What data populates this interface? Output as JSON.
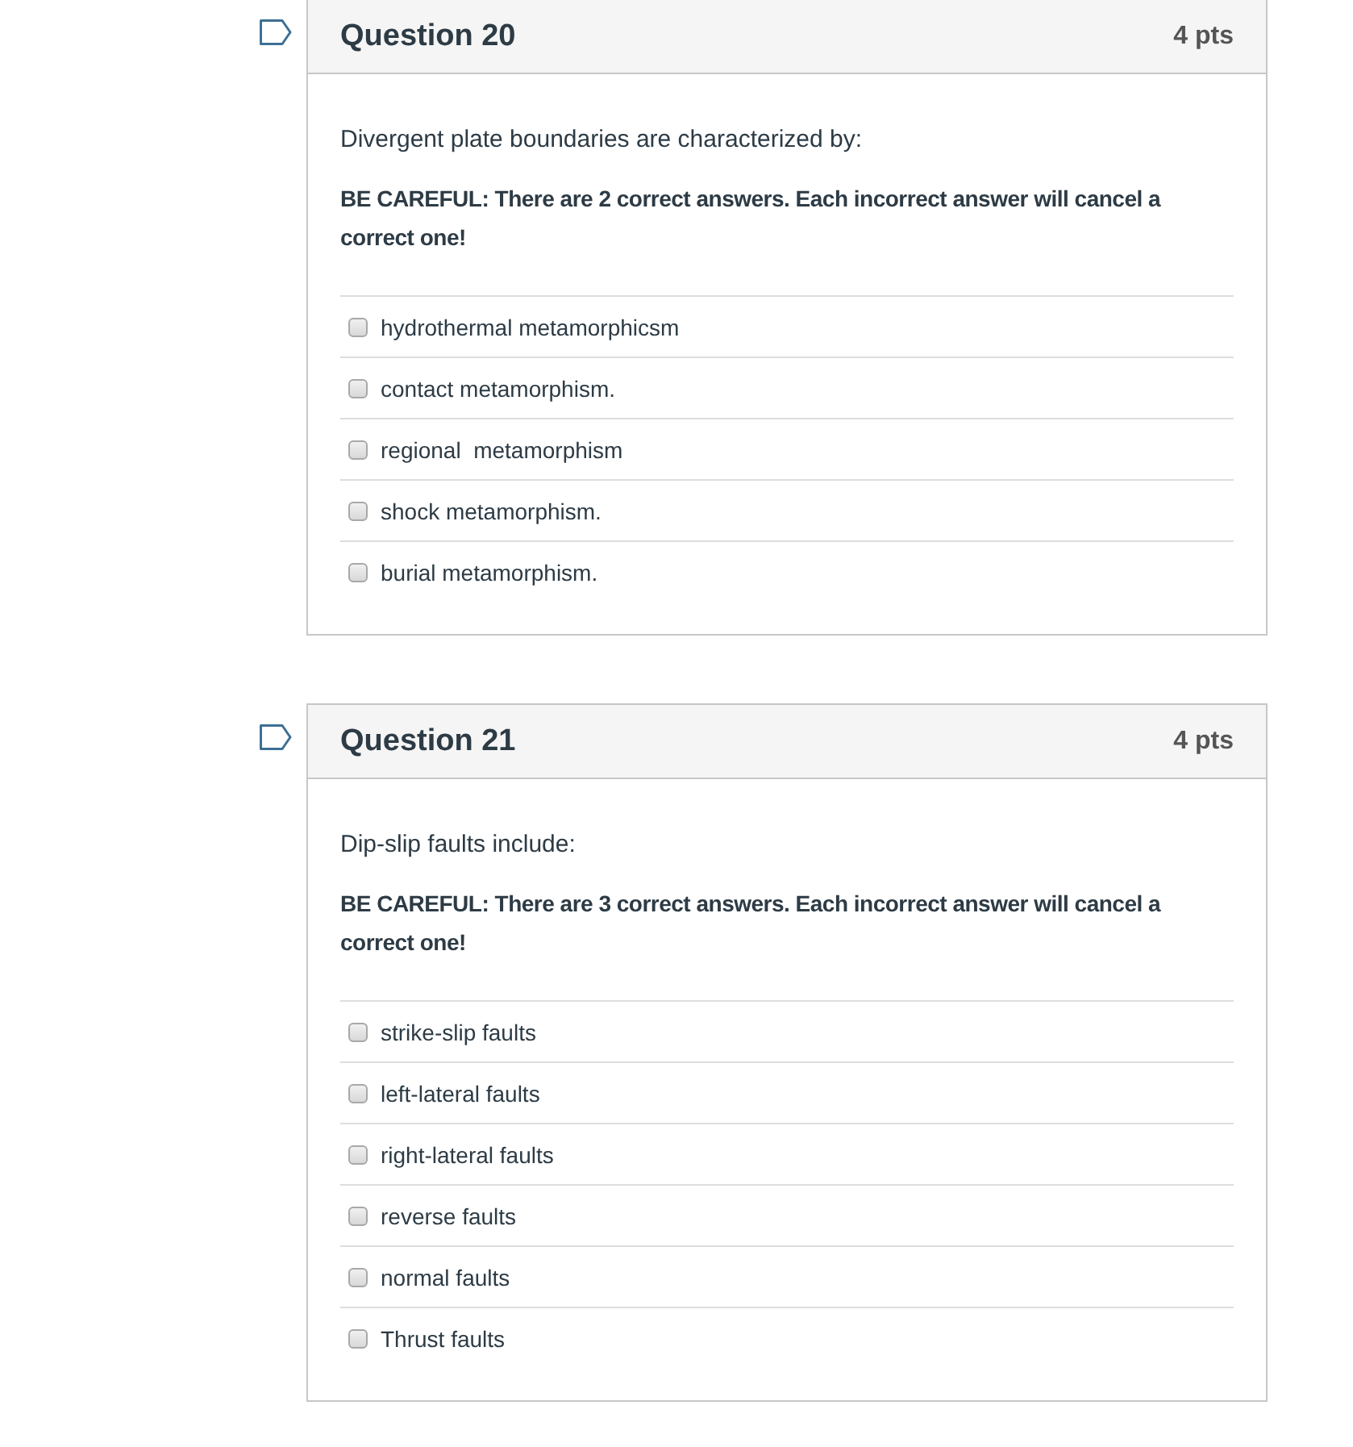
{
  "questions": [
    {
      "title": "Question 20",
      "points": "4 pts",
      "flagged": false,
      "prompt": "Divergent plate boundaries are characterized by:",
      "warning": "BE CAREFUL: There are 2 correct answers. Each incorrect answer will cancel a correct one!",
      "answers": [
        {
          "label": "hydrothermal metamorphicsm",
          "checked": false
        },
        {
          "label": "contact metamorphism.",
          "checked": false
        },
        {
          "label": "regional  metamorphism",
          "checked": false
        },
        {
          "label": "shock metamorphism.",
          "checked": false
        },
        {
          "label": "burial metamorphism.",
          "checked": false
        }
      ]
    },
    {
      "title": "Question 21",
      "points": "4 pts",
      "flagged": false,
      "prompt": "Dip-slip faults include:",
      "warning": "BE CAREFUL: There are 3 correct answers. Each incorrect answer will cancel a correct one!",
      "answers": [
        {
          "label": "strike-slip faults",
          "checked": false
        },
        {
          "label": "left-lateral faults",
          "checked": false
        },
        {
          "label": "right-lateral faults",
          "checked": false
        },
        {
          "label": "reverse faults",
          "checked": false
        },
        {
          "label": "normal faults",
          "checked": false
        },
        {
          "label": "Thrust faults",
          "checked": false
        }
      ]
    }
  ]
}
